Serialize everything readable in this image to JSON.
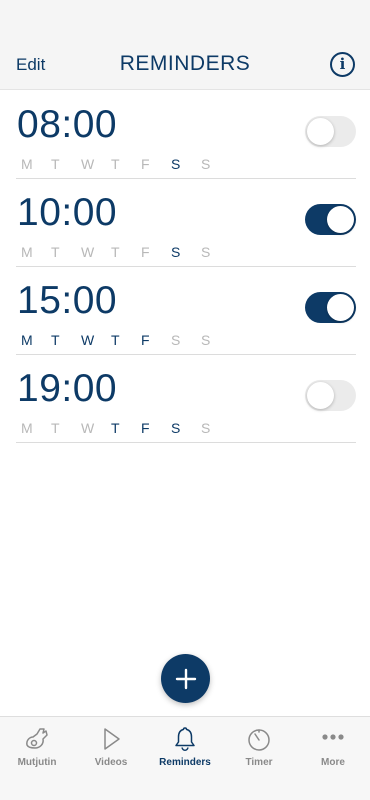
{
  "header": {
    "edit_label": "Edit",
    "title": "REMINDERS",
    "info_glyph": "i"
  },
  "reminders": [
    {
      "time": "08:00",
      "enabled": false,
      "days": [
        {
          "l": "M",
          "on": false
        },
        {
          "l": "T",
          "on": false
        },
        {
          "l": "W",
          "on": false
        },
        {
          "l": "T",
          "on": false
        },
        {
          "l": "F",
          "on": false
        },
        {
          "l": "S",
          "on": true
        },
        {
          "l": "S",
          "on": false
        }
      ]
    },
    {
      "time": "10:00",
      "enabled": true,
      "days": [
        {
          "l": "M",
          "on": false
        },
        {
          "l": "T",
          "on": false
        },
        {
          "l": "W",
          "on": false
        },
        {
          "l": "T",
          "on": false
        },
        {
          "l": "F",
          "on": false
        },
        {
          "l": "S",
          "on": true
        },
        {
          "l": "S",
          "on": false
        }
      ]
    },
    {
      "time": "15:00",
      "enabled": true,
      "days": [
        {
          "l": "M",
          "on": true
        },
        {
          "l": "T",
          "on": true
        },
        {
          "l": "W",
          "on": true
        },
        {
          "l": "T",
          "on": true
        },
        {
          "l": "F",
          "on": true
        },
        {
          "l": "S",
          "on": false
        },
        {
          "l": "S",
          "on": false
        }
      ]
    },
    {
      "time": "19:00",
      "enabled": false,
      "days": [
        {
          "l": "M",
          "on": false
        },
        {
          "l": "T",
          "on": false
        },
        {
          "l": "W",
          "on": false
        },
        {
          "l": "T",
          "on": true
        },
        {
          "l": "F",
          "on": true
        },
        {
          "l": "S",
          "on": true
        },
        {
          "l": "S",
          "on": false
        }
      ]
    }
  ],
  "add_button": {
    "icon": "plus-icon"
  },
  "tabs": [
    {
      "label": "Mutjutin",
      "icon": "mutjutin-icon",
      "active": false
    },
    {
      "label": "Videos",
      "icon": "play-icon",
      "active": false
    },
    {
      "label": "Reminders",
      "icon": "bell-icon",
      "active": true
    },
    {
      "label": "Timer",
      "icon": "timer-icon",
      "active": false
    },
    {
      "label": "More",
      "icon": "more-dots-icon",
      "active": false
    }
  ],
  "colors": {
    "accent": "#0d3a66",
    "inactive_day": "#b8b8b8",
    "toggle_off": "#ebebeb",
    "tab_inactive": "#8a8a8a"
  }
}
